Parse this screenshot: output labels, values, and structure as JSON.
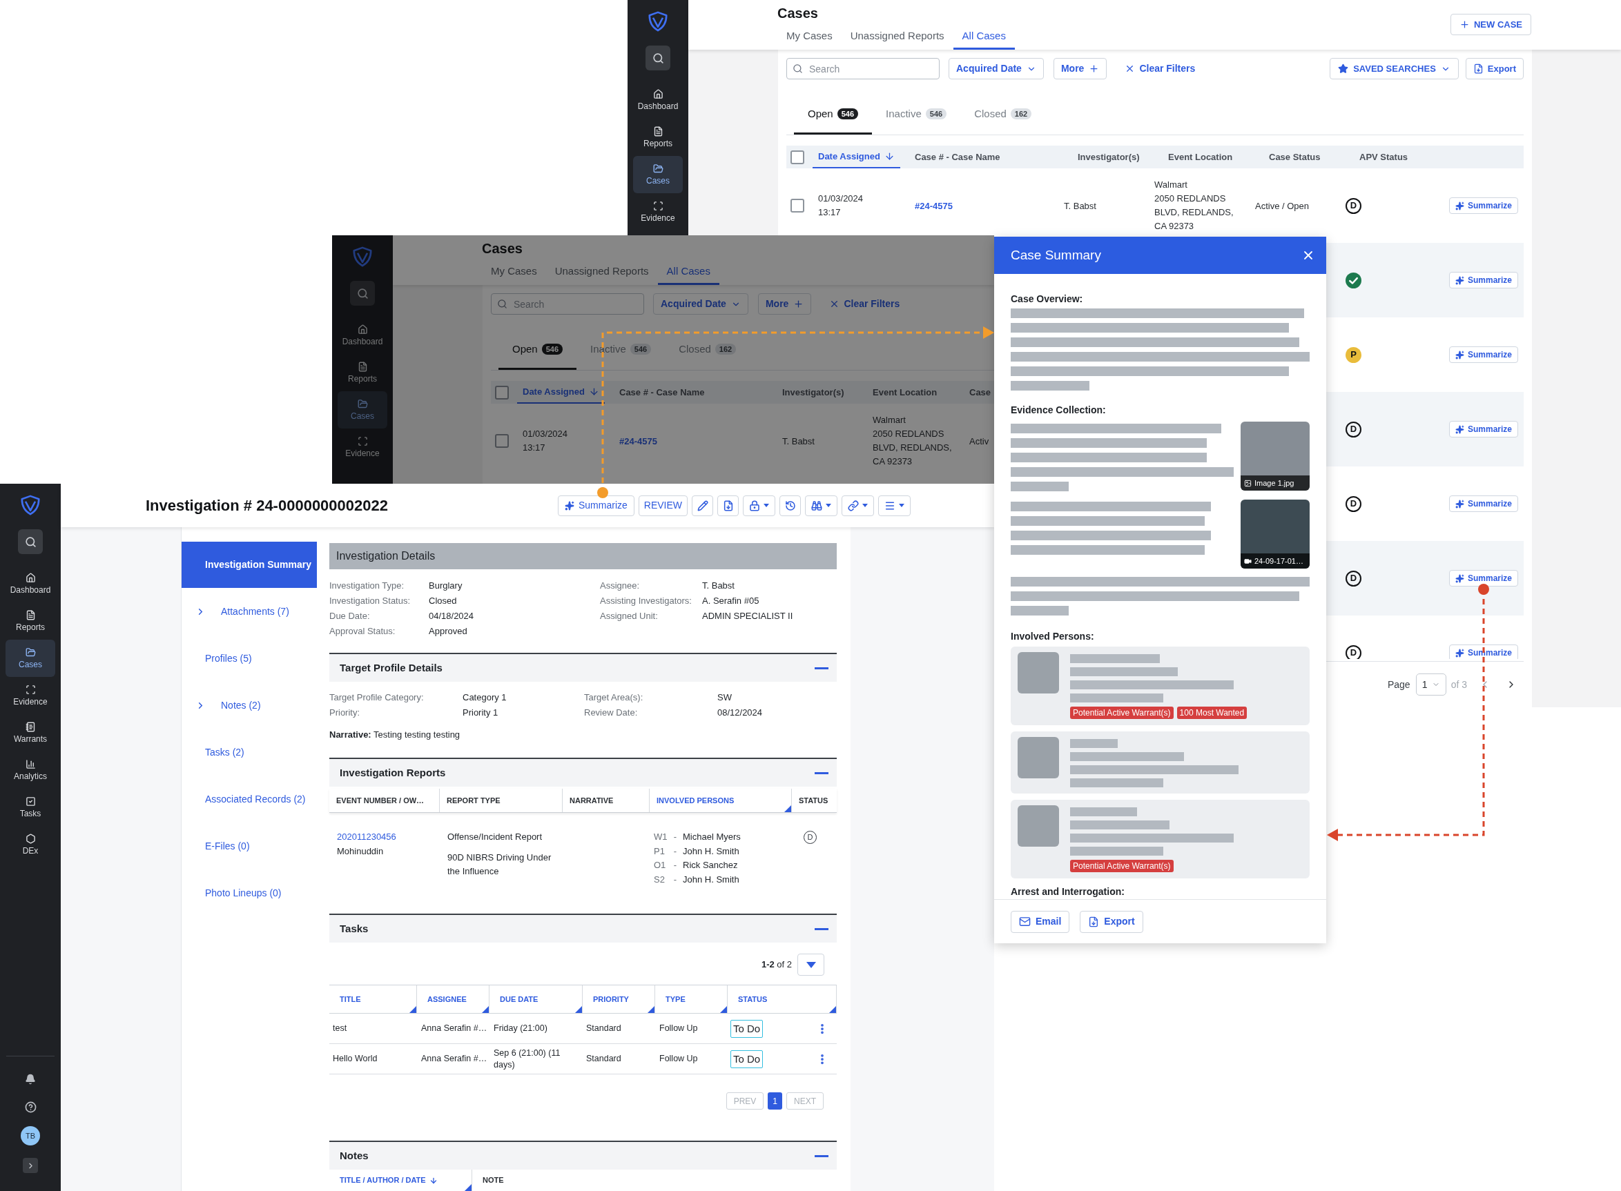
{
  "cases_window": {
    "sidebar": [
      {
        "label": "Dashboard",
        "selected": false
      },
      {
        "label": "Reports",
        "selected": false
      },
      {
        "label": "Cases",
        "selected": true
      },
      {
        "label": "Evidence",
        "selected": false
      }
    ],
    "title": "Cases",
    "tabs": [
      {
        "label": "My Cases",
        "selected": false
      },
      {
        "label": "Unassigned Reports",
        "selected": false
      },
      {
        "label": "All Cases",
        "selected": true
      }
    ],
    "new_case_button": "NEW CASE",
    "search": {
      "placeholder": "Search"
    },
    "filters": [
      {
        "kind": "dropdown",
        "label": "Acquired Date"
      },
      {
        "kind": "add",
        "label": "More"
      },
      {
        "kind": "clear",
        "label": "Clear Filters"
      }
    ],
    "saved_searches_button": "SAVED SEARCHES",
    "export_button": "Export",
    "status_tabs": [
      {
        "label": "Open",
        "count": "546",
        "selected": true
      },
      {
        "label": "Inactive",
        "count": "546",
        "selected": false
      },
      {
        "label": "Closed",
        "count": "162",
        "selected": false
      }
    ],
    "select_all": {
      "checked": false
    },
    "columns": [
      {
        "label": "Date Assigned",
        "sorted": true
      },
      {
        "label": "Case # - Case Name",
        "sorted": false
      },
      {
        "label": "Investigator(s)",
        "sorted": false
      },
      {
        "label": "Event Location",
        "sorted": false
      },
      {
        "label": "Case Status",
        "sorted": false
      },
      {
        "label": "APV Status",
        "sorted": false
      }
    ],
    "rows": [
      {
        "checked": false,
        "date": "01/03/2024",
        "time": "13:17",
        "case_number": "#24-4575",
        "investigator": "T. Babst",
        "location_name": "Walmart",
        "address": "2050 REDLANDS BLVD, REDLANDS, CA 92373",
        "case_status": "Active / Open",
        "apv": {
          "kind": "letter",
          "text": "D"
        },
        "action": "Summarize"
      },
      {
        "apv": {
          "kind": "check",
          "color": "#1d7a4e"
        },
        "action": "Summarize"
      },
      {
        "apv": {
          "kind": "filled",
          "text": "P",
          "color": "#e9bc3b"
        },
        "action": "Summarize"
      },
      {
        "apv": {
          "kind": "letter",
          "text": "D"
        },
        "action": "Summarize"
      },
      {
        "apv": {
          "kind": "letter",
          "text": "D"
        },
        "action": "Summarize"
      },
      {
        "apv": {
          "kind": "letter",
          "text": "D"
        },
        "action": "Summarize"
      },
      {
        "apv": {
          "kind": "letter",
          "text": "D"
        },
        "action": "Summarize"
      }
    ],
    "pagination": {
      "label": "Page",
      "page": "1",
      "total": "of 3"
    }
  },
  "background_cases_window": {
    "dimmed": true,
    "sidebar": [
      {
        "label": "Dashboard",
        "selected": false
      },
      {
        "label": "Reports",
        "selected": false
      },
      {
        "label": "Cases",
        "selected": true
      },
      {
        "label": "Evidence",
        "selected": false
      }
    ],
    "title": "Cases",
    "tabs": [
      {
        "label": "My Cases",
        "selected": false
      },
      {
        "label": "Unassigned Reports",
        "selected": false
      },
      {
        "label": "All Cases",
        "selected": true
      }
    ],
    "search": {
      "placeholder": "Search"
    },
    "filters": [
      {
        "kind": "dropdown",
        "label": "Acquired Date"
      },
      {
        "kind": "add",
        "label": "More"
      },
      {
        "kind": "clear",
        "label": "Clear Filters"
      }
    ],
    "status_tabs": [
      {
        "label": "Open",
        "count": "546",
        "selected": true
      },
      {
        "label": "Inactive",
        "count": "546",
        "selected": false
      },
      {
        "label": "Closed",
        "count": "162",
        "selected": false
      }
    ],
    "select_all": {
      "checked": false
    },
    "columns": [
      {
        "label": "Date Assigned",
        "sorted": true
      },
      {
        "label": "Case # - Case Name",
        "sorted": false
      },
      {
        "label": "Investigator(s)",
        "sorted": false
      },
      {
        "label": "Event Location",
        "sorted": false
      },
      {
        "label": "Case",
        "sorted": false
      }
    ],
    "rows": [
      {
        "checked": false,
        "date": "01/03/2024",
        "time": "13:17",
        "case_number": "#24-4575",
        "investigator": "T. Babst",
        "location_name": "Walmart",
        "address": "2050 REDLANDS BLVD, REDLANDS, CA 92373",
        "case_status": "Activ"
      }
    ]
  },
  "case_summary": {
    "title": "Case Summary",
    "sections": [
      {
        "kind": "text",
        "heading": "Case Overview:"
      },
      {
        "kind": "evidence",
        "heading": "Evidence Collection:",
        "attachments": [
          {
            "kind": "image",
            "caption": "Image 1.jpg"
          },
          {
            "kind": "video",
            "caption": "24-09-17-01…"
          }
        ]
      },
      {
        "kind": "persons",
        "heading": "Involved Persons:",
        "persons": [
          {
            "kind": "tagged",
            "tags": [
              "Potential Active Warrant(s)",
              "100 Most Wanted"
            ]
          },
          {
            "kind": "plain"
          },
          {
            "kind": "tagged",
            "tags": [
              "Potential Active Warrant(s)"
            ]
          }
        ]
      },
      {
        "kind": "heading",
        "heading": "Arrest and Interrogation:"
      }
    ],
    "buttons": [
      {
        "kind": "email",
        "label": "Email"
      },
      {
        "kind": "export",
        "label": "Export"
      }
    ]
  },
  "investigation_window": {
    "sidebar": [
      {
        "label": "Dashboard",
        "selected": false
      },
      {
        "label": "Reports",
        "selected": false
      },
      {
        "label": "Cases",
        "selected": true
      },
      {
        "label": "Evidence",
        "selected": false
      },
      {
        "label": "Warrants",
        "selected": false
      },
      {
        "label": "Analytics",
        "selected": false
      },
      {
        "label": "Tasks",
        "selected": false
      },
      {
        "label": "DEx",
        "selected": false
      }
    ],
    "user": {
      "initials": "TB"
    },
    "title": "Investigation # 24-0000000002022",
    "toolbar": [
      {
        "kind": "ai",
        "label": "Summarize"
      },
      {
        "kind": "text",
        "label": "REVIEW"
      },
      {
        "kind": "icon",
        "dropdown": false
      },
      {
        "kind": "icon",
        "dropdown": false
      },
      {
        "kind": "icon",
        "dropdown": true
      },
      {
        "kind": "icon",
        "dropdown": false
      },
      {
        "kind": "icon",
        "dropdown": true
      },
      {
        "kind": "icon",
        "dropdown": true
      },
      {
        "kind": "icon",
        "dropdown": true
      }
    ],
    "nav": [
      {
        "label": "Investigation Summary",
        "selected": true,
        "expandable": false
      },
      {
        "label": "Attachments (7)",
        "selected": false,
        "expandable": true
      },
      {
        "label": "Profiles (5)",
        "selected": false,
        "expandable": false
      },
      {
        "label": "Notes (2)",
        "selected": false,
        "expandable": true
      },
      {
        "label": "Tasks (2)",
        "selected": false,
        "expandable": false
      },
      {
        "label": "Associated Records (2)",
        "selected": false,
        "expandable": false
      },
      {
        "label": "E-Files (0)",
        "selected": false,
        "expandable": false
      },
      {
        "label": "Photo Lineups (0)",
        "selected": false,
        "expandable": false
      }
    ],
    "details": {
      "title": "Investigation Details",
      "left": [
        {
          "label": "Investigation Type:",
          "value": "Burglary"
        },
        {
          "label": "Investigation Status:",
          "value": "Closed"
        },
        {
          "label": "Due Date:",
          "value": "04/18/2024"
        },
        {
          "label": "Approval Status:",
          "value": "Approved"
        }
      ],
      "right": [
        {
          "label": "Assignee:",
          "value": "T. Babst"
        },
        {
          "label": "Assisting Investigators:",
          "value": "A. Serafin #05"
        },
        {
          "label": "Assigned Unit:",
          "value": "ADMIN SPECIALIST II"
        }
      ]
    },
    "target_profile": {
      "title": "Target Profile Details",
      "expanded": true,
      "left": [
        {
          "label": "Target Profile Category:",
          "value": "Category 1"
        },
        {
          "label": "Priority:",
          "value": "Priority 1"
        }
      ],
      "right": [
        {
          "label": "Target Area(s):",
          "value": "SW"
        },
        {
          "label": "Review Date:",
          "value": "08/12/2024"
        }
      ],
      "narrative": "**Narrative:** Testing testing testing"
    },
    "reports": {
      "title": "Investigation Reports",
      "expanded": true,
      "columns": [
        {
          "label": "EVENT NUMBER / OW…",
          "highlighted": false
        },
        {
          "label": "REPORT TYPE",
          "highlighted": false
        },
        {
          "label": "NARRATIVE",
          "highlighted": false
        },
        {
          "label": "INVOLVED PERSONS",
          "highlighted": true
        },
        {
          "label": "STATUS",
          "highlighted": false
        }
      ],
      "rows": [
        {
          "event_number": "202011230456",
          "owner": "Mohinuddin",
          "report_types": [
            "Offense/Incident Report",
            "90D NIBRS Driving Under the Influence"
          ],
          "persons": [
            {
              "role": "W1",
              "separator": "-",
              "name": "Michael Myers"
            },
            {
              "role": "P1",
              "separator": "-",
              "name": "John H. Smith"
            },
            {
              "role": "O1",
              "separator": "-",
              "name": "Rick Sanchez"
            },
            {
              "role": "S2",
              "separator": "-",
              "name": "John H. Smith"
            }
          ],
          "status": "D"
        }
      ]
    },
    "tasks": {
      "title": "Tasks",
      "expanded": true,
      "range": "**1-2** of 2",
      "columns": [
        {
          "label": "TITLE",
          "highlighted": true
        },
        {
          "label": "ASSIGNEE",
          "highlighted": true
        },
        {
          "label": "DUE DATE",
          "highlighted": true
        },
        {
          "label": "PRIORITY",
          "highlighted": true
        },
        {
          "label": "TYPE",
          "highlighted": true
        },
        {
          "label": "STATUS",
          "highlighted": true
        }
      ],
      "rows": [
        {
          "title": "test",
          "assignee": "Anna Serafin #…",
          "due": "Friday (21:00)",
          "priority": "Standard",
          "type": "Follow Up",
          "status": "To Do"
        },
        {
          "title": "Hello World",
          "assignee": "Anna Serafin #…",
          "due": "Sep 6 (21:00) (11 days)",
          "priority": "Standard",
          "type": "Follow Up",
          "status": "To Do"
        }
      ],
      "pagination": {
        "prev": {
          "label": "PREV",
          "disabled": true
        },
        "pages": [
          {
            "label": "1",
            "selected": true
          }
        ],
        "next": {
          "label": "NEXT",
          "disabled": true
        }
      }
    },
    "notes": {
      "title": "Notes",
      "expanded": true,
      "columns": [
        {
          "label": "TITLE / AUTHOR / DATE",
          "highlighted": true,
          "sorted": true
        },
        {
          "label": "NOTE",
          "highlighted": false,
          "sorted": false
        }
      ]
    }
  }
}
